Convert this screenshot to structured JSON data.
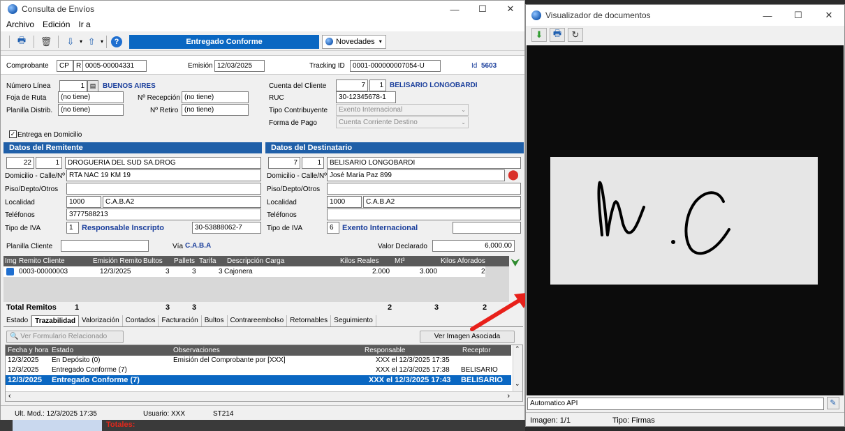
{
  "main": {
    "title": "Consulta de Envíos",
    "menu": [
      "Archivo",
      "Edición",
      "Ir a"
    ],
    "status_banner": "Entregado Conforme",
    "novedades_label": "Novedades",
    "header": {
      "comprobante_label": "Comprobante",
      "comp_type": "CP",
      "comp_letter": "R",
      "comp_number": "0005-00004331",
      "emision_label": "Emisión",
      "emision_value": "12/03/2025",
      "tracking_label": "Tracking ID",
      "tracking_value": "0001-000000007054-U",
      "id_label": "Id",
      "id_value": "5603"
    },
    "left_info": {
      "numero_linea_label": "Número Línea",
      "numero_linea_value": "1",
      "numero_linea_name": "BUENOS AIRES",
      "foja_label": "Foja de Ruta",
      "foja_value": "(no tiene)",
      "planilla_label": "Planilla Distrib.",
      "planilla_value": "(no tiene)",
      "recepcion_label": "Nº Recepción",
      "recepcion_value": "(no tiene)",
      "retiro_label": "Nº Retiro",
      "retiro_value": "(no tiene)",
      "entrega_domicilio": "Entrega en Domicilio"
    },
    "right_info": {
      "cuenta_label": "Cuenta del Cliente",
      "cuenta_num": "7",
      "cuenta_sub": "1",
      "cuenta_name": "BELISARIO LONGOBARDI",
      "ruc_label": "RUC",
      "ruc_value": "30-12345678-1",
      "tipo_contrib_label": "Tipo Contribuyente",
      "tipo_contrib_value": "Exento Internacional",
      "forma_pago_label": "Forma de Pago",
      "forma_pago_value": "Cuenta Corriente Destino"
    },
    "remitente": {
      "heading": "Datos del Remitente",
      "code": "22",
      "sub": "1",
      "name": "DROGUERIA DEL SUD SA.DROG",
      "domicilio_label": "Domicilio - Calle/Nº",
      "domicilio_value": "RTA NAC 19 KM 19",
      "piso_label": "Piso/Depto/Otros",
      "piso_value": "",
      "localidad_label": "Localidad",
      "cp": "1000",
      "localidad": "C.A.B.A2",
      "telefonos_label": "Teléfonos",
      "telefonos_value": "3777588213",
      "iva_label": "Tipo de IVA",
      "iva_code": "1",
      "iva_name": "Responsable Inscripto",
      "cuit": "30-53888062-7"
    },
    "destinatario": {
      "heading": "Datos del Destinatario",
      "code": "7",
      "sub": "1",
      "name": "BELISARIO LONGOBARDI",
      "domicilio_label": "Domicilio - Calle/Nº",
      "domicilio_value": "José María Paz 899",
      "piso_label": "Piso/Depto/Otros",
      "piso_value": "",
      "localidad_label": "Localidad",
      "cp": "1000",
      "localidad": "C.A.B.A2",
      "telefonos_label": "Teléfonos",
      "telefonos_value": "",
      "iva_label": "Tipo de IVA",
      "iva_code": "6",
      "iva_name": "Exento Internacional",
      "cuit": ""
    },
    "planilla_cliente_label": "Planilla Cliente",
    "via_label": "Vía",
    "via_value": "C.A.B.A",
    "valor_declarado_label": "Valor Declarado",
    "valor_declarado_value": "6,000.00",
    "remitos_grid": {
      "headers": [
        "Img",
        "Remito Cliente",
        "Emisión Remito",
        "Bultos",
        "Pallets",
        "Tarifa",
        "Descripción Carga",
        "Kilos Reales",
        "Mt³",
        "Kilos Aforados"
      ],
      "row": {
        "remito": "0003-00000003",
        "emision": "12/3/2025",
        "bultos": "3",
        "pallets": "3",
        "tarifa": "3",
        "descripcion": "Cajonera",
        "kilos": "2.000",
        "mt3": "3.000",
        "aforados": "2"
      },
      "totals_label": "Total Remitos",
      "totals": {
        "remitos": "1",
        "bultos": "3",
        "pallets": "3",
        "kilos": "2",
        "mt3": "3",
        "aforados": "2"
      }
    },
    "tabs": [
      "Estado",
      "Trazabilidad",
      "Valorización",
      "Contados",
      "Facturación",
      "Bultos",
      "Contrareembolso",
      "Retornables",
      "Seguimiento"
    ],
    "ver_formulario_label": "Ver Formulario Relacionado",
    "ver_imagen_label": "Ver Imagen Asociada",
    "traz_grid": {
      "headers": [
        "Fecha y hora",
        "Estado",
        "Observaciones",
        "Responsable",
        "Receptor"
      ],
      "rows": [
        {
          "fecha": "12/3/2025",
          "estado": "En Depósito (0)",
          "obs": "Emisión del Comprobante por [XXX]",
          "resp": "XXX el 12/3/2025 17:35",
          "recep": ""
        },
        {
          "fecha": "12/3/2025",
          "estado": "Entregado Conforme (7)",
          "obs": "",
          "resp": "XXX el 12/3/2025 17:38",
          "recep": "BELISARIO LON("
        },
        {
          "fecha": "12/3/2025",
          "estado": "Entregado Conforme (7)",
          "obs": "",
          "resp": "XXX el 12/3/2025 17:43",
          "recep": "BELISARIO LO"
        }
      ]
    },
    "status": {
      "ult_mod": "Ult. Mod.: 12/3/2025 17:35",
      "usuario": "Usuario: XXX",
      "station": "ST214"
    },
    "totales_label": "Totales:"
  },
  "viewer": {
    "title": "Visualizador de documentos",
    "signature_text": "M.C",
    "source_value": "Automatico API",
    "imagen_label": "Imagen: 1/1",
    "tipo_label": "Tipo: Firmas"
  },
  "colors": {
    "banner": "#0a67c2",
    "section": "#1f5fa8",
    "selected_row": "#0a67c2",
    "arrow": "#e8201a"
  }
}
